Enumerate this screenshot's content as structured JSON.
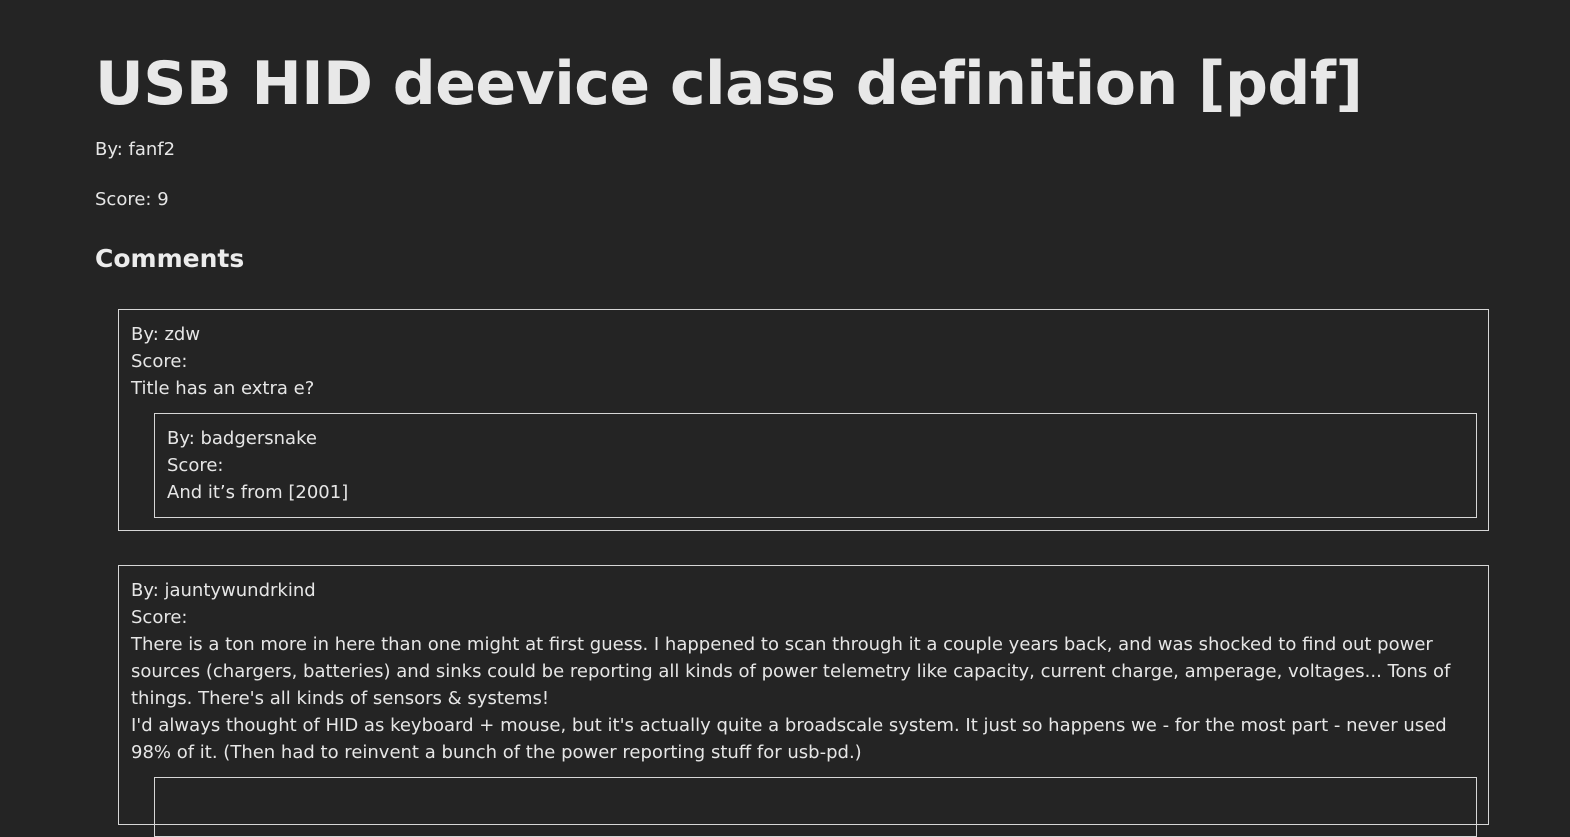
{
  "post": {
    "title": "USB HID deevice class definition [pdf]",
    "by": "By: fanf2",
    "score": "Score: 9"
  },
  "comments_heading": "Comments",
  "comments": [
    {
      "by": "By: zdw",
      "score": "Score:",
      "text": "Title has an extra e?",
      "replies": [
        {
          "by": "By: badgersnake",
          "score": "Score:",
          "text": "And it’s from [2001]"
        }
      ]
    },
    {
      "by": "By: jauntywundrkind",
      "score": "Score:",
      "text_lines": [
        "There is a ton more in here than one might at first guess. I happened to scan through it a couple years back, and was shocked to find out power sources (chargers, batteries) and sinks could be reporting all kinds of power telemetry like capacity, current charge, amperage, voltages... Tons of things. There's all kinds of sensors & systems!",
        "I'd always thought of HID as keyboard + mouse, but it's actually quite a broadscale system. It just so happens we - for the most part - never used 98% of it. (Then had to reinvent a bunch of the power reporting stuff for usb-pd.)"
      ]
    }
  ]
}
